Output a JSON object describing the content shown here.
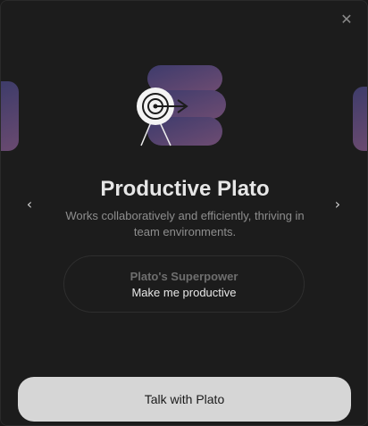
{
  "modal": {
    "close_icon": "close-icon",
    "title": "Productive Plato",
    "description": "Works collaboratively and efficiently, thriving in team environments.",
    "nav": {
      "prev_icon": "chevron-left-icon",
      "next_icon": "chevron-right-icon"
    },
    "superpower": {
      "label": "Plato's Superpower",
      "value": "Make me productive"
    },
    "cta_label": "Talk with Plato",
    "colors": {
      "background": "#1c1c1c",
      "accent_gradient_start": "#3e3c6a",
      "accent_gradient_end": "#6a4a70",
      "button_bg": "#d6d6d6"
    }
  }
}
